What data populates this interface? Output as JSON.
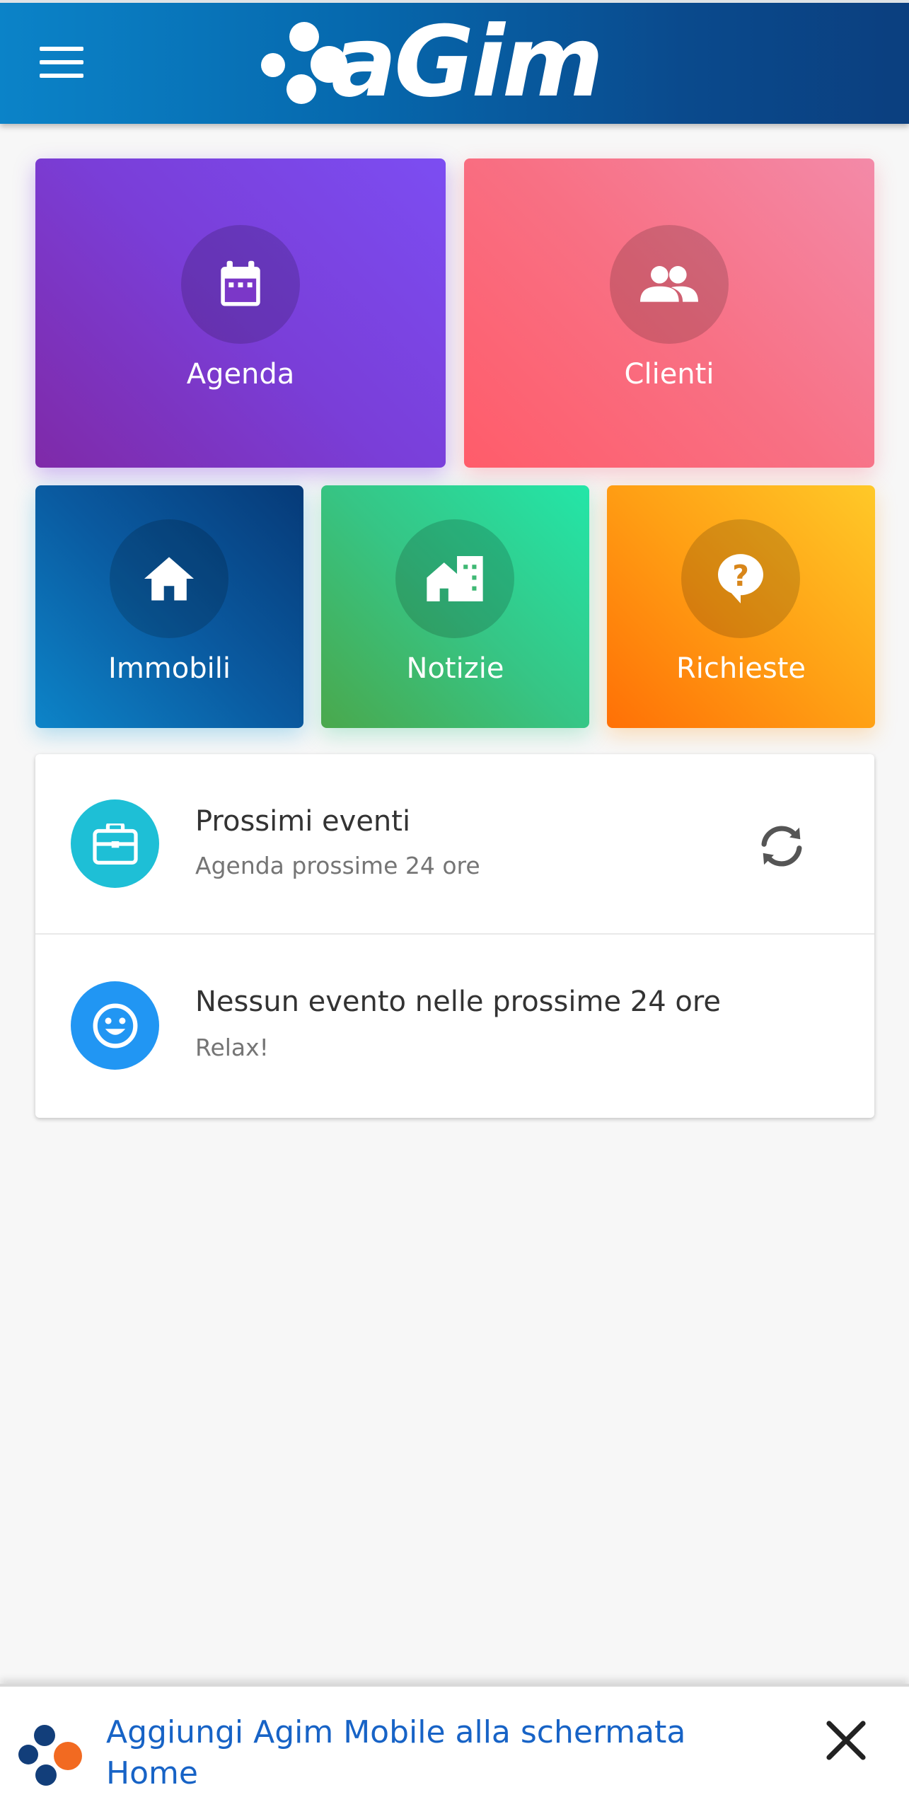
{
  "header": {
    "logo_text": "aGim",
    "menu_icon": "menu-icon"
  },
  "tiles": [
    {
      "label": "Agenda",
      "icon": "calendar-icon"
    },
    {
      "label": "Clienti",
      "icon": "people-icon"
    },
    {
      "label": "Immobili",
      "icon": "home-icon"
    },
    {
      "label": "Notizie",
      "icon": "buildings-icon"
    },
    {
      "label": "Richieste",
      "icon": "question-icon"
    }
  ],
  "events": {
    "title": "Prossimi eventi",
    "subtitle": "Agenda prossime 24 ore",
    "empty_title": "Nessun evento nelle prossime 24 ore",
    "empty_subtitle": "Relax!",
    "icons": [
      "briefcase-icon",
      "smiley-icon",
      "refresh-icon"
    ]
  },
  "install_banner": {
    "text": "Aggiungi Agim Mobile alla schermata Home",
    "close_icon": "close-icon"
  },
  "colors": {
    "header": "#0668ad",
    "agenda": "#7a3ed8",
    "clienti": "#f87084",
    "immobili": "#0a5aa0",
    "notizie": "#36c585",
    "richieste": "#ff9f14",
    "events_avatar": "#1ebfd6",
    "empty_avatar": "#2196f3",
    "banner_link": "#1763c6"
  }
}
